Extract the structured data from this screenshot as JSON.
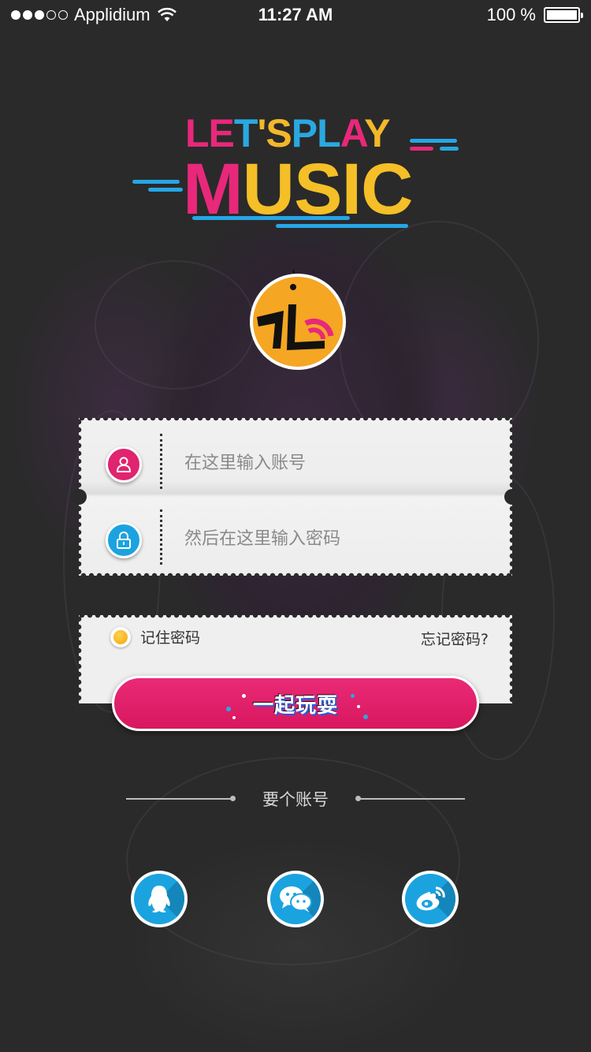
{
  "status_bar": {
    "carrier": "Applidium",
    "time": "11:27 AM",
    "battery": "100 %",
    "signal_bars_filled": 3,
    "signal_bars_total": 5,
    "battery_level": 1.0
  },
  "logo": {
    "line1": "LET'SPLAY",
    "line2": "MUSIC"
  },
  "login": {
    "account_placeholder": "在这里输入账号",
    "password_placeholder": "然后在这里输入密码",
    "remember_label": "记住密码",
    "forgot_label": "忘记密码?",
    "submit_label": "一起玩耍"
  },
  "register": {
    "label": "要个账号"
  },
  "social": {
    "items": [
      {
        "name": "qq",
        "icon": "qq-penguin-icon"
      },
      {
        "name": "wechat",
        "icon": "wechat-icon"
      },
      {
        "name": "weibo",
        "icon": "weibo-icon"
      }
    ]
  },
  "colors": {
    "brand_pink": "#e8287a",
    "brand_blue": "#1ba3e0",
    "brand_yellow": "#f5bf27",
    "background": "#2a2a2a"
  }
}
